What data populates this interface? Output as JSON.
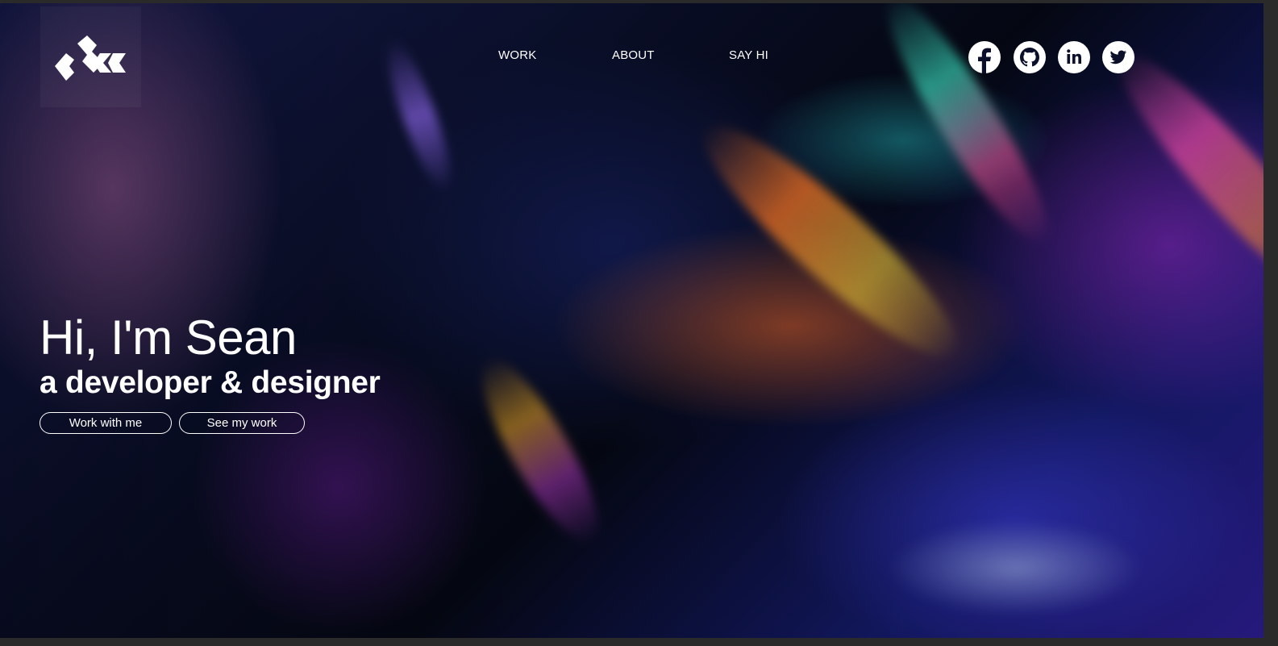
{
  "nav": {
    "work": "WORK",
    "about": "ABOUT",
    "say_hi": "SAY HI"
  },
  "socials": [
    {
      "icon": "facebook-icon"
    },
    {
      "icon": "github-icon"
    },
    {
      "icon": "linkedin-icon"
    },
    {
      "icon": "twitter-icon"
    }
  ],
  "hero": {
    "headline": "Hi, I'm Sean",
    "subline": "a developer & designer",
    "cta_primary": "Work with me",
    "cta_secondary": "See my work"
  },
  "colors": {
    "text": "#ffffff",
    "background_dark": "#050814",
    "accent_blue": "#2a1c8a"
  }
}
